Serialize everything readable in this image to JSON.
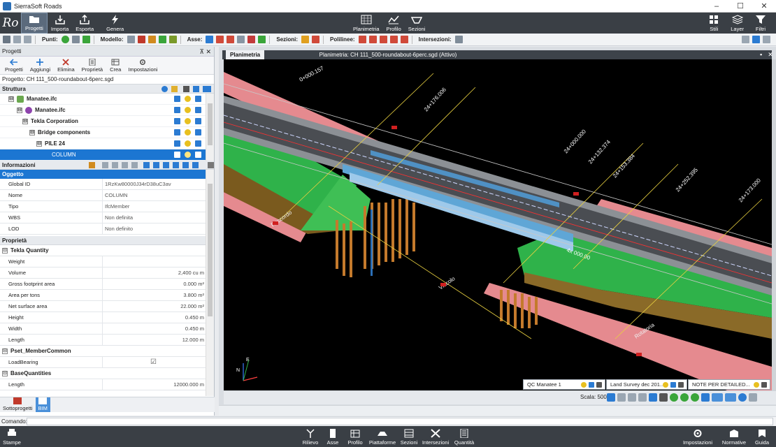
{
  "app": {
    "title": "SierraSoft Roads",
    "logo_text": "Ro",
    "window_controls": [
      "–",
      "☐",
      "✕"
    ]
  },
  "ribbon": {
    "left": [
      {
        "label": "Progetti",
        "icon": "folder-icon",
        "active": true
      },
      {
        "label": "Importa",
        "icon": "import-icon"
      },
      {
        "label": "Esporta",
        "icon": "export-icon"
      },
      {
        "label": "Genera",
        "icon": "generate-icon"
      }
    ],
    "center": [
      {
        "label": "Planimetria",
        "icon": "plan-icon"
      },
      {
        "label": "Profilo",
        "icon": "profile-icon"
      },
      {
        "label": "Sezioni",
        "icon": "sections-icon"
      }
    ],
    "right": [
      {
        "label": "Stili",
        "icon": "styles-icon"
      },
      {
        "label": "Layer",
        "icon": "layer-icon"
      },
      {
        "label": "Filtri",
        "icon": "filter-icon"
      }
    ]
  },
  "toolbar": {
    "groups": [
      {
        "label": "Punti:"
      },
      {
        "label": "Modello:"
      },
      {
        "label": "Asse:"
      },
      {
        "label": "Sezioni:"
      },
      {
        "label": "Polilinee:"
      },
      {
        "label": "Intersezioni:"
      }
    ]
  },
  "left_panel": {
    "title": "Progetti",
    "pin": "⊼ ✕",
    "buttons": [
      {
        "label": "Progetti",
        "icon": "back-arrow-icon"
      },
      {
        "label": "Aggiungi",
        "icon": "add-icon"
      },
      {
        "label": "Elimina",
        "icon": "delete-icon"
      },
      {
        "label": "Proprietà",
        "icon": "properties-icon"
      },
      {
        "label": "Crea",
        "icon": "create-icon"
      },
      {
        "label": "Impostazioni",
        "icon": "settings-icon"
      }
    ],
    "project_label": "Progetto: CH 111_500-roundabout-6perc.sgd",
    "structure_title": "Struttura",
    "tree": [
      {
        "label": "Manatee.ifc",
        "level": 0,
        "expander": "⊟"
      },
      {
        "label": "Manatee.ifc",
        "level": 1,
        "expander": "⊟"
      },
      {
        "label": "Tekla Corporation",
        "level": 2,
        "expander": "⊟"
      },
      {
        "label": "Bridge components",
        "level": 3,
        "expander": "⊟"
      },
      {
        "label": "PILE 24",
        "level": 4,
        "expander": "⊟"
      },
      {
        "label": "COLUMN",
        "level": 5,
        "expander": "",
        "selected": true
      }
    ],
    "info_title": "Informazioni",
    "object_header": "Oggetto",
    "object_props": [
      {
        "key": "Global ID",
        "value": "1RzKw80000J34rD38uC3av"
      },
      {
        "key": "Nome",
        "value": "COLUMN"
      },
      {
        "key": "Tipo",
        "value": "IfcMember"
      },
      {
        "key": "WBS",
        "value": "Non definita"
      },
      {
        "key": "LOD",
        "value": "Non definito"
      }
    ],
    "properties_title": "Proprietà",
    "groups": [
      {
        "name": "Tekla Quantity",
        "rows": [
          {
            "key": "Weight",
            "value": ""
          },
          {
            "key": "Volume",
            "value": "2,400 cu m"
          },
          {
            "key": "Gross footprint area",
            "value": "0.000 m²"
          },
          {
            "key": "Area per tons",
            "value": "3.800 m²"
          },
          {
            "key": "Net surface area",
            "value": "22.000 m²"
          },
          {
            "key": "Height",
            "value": "0.450 m"
          },
          {
            "key": "Width",
            "value": "0.450 m"
          },
          {
            "key": "Length",
            "value": "12.000 m"
          }
        ]
      },
      {
        "name": "Pset_MemberCommon",
        "rows": [
          {
            "key": "LoadBearing",
            "value": "☑"
          }
        ]
      },
      {
        "name": "BaseQuantities",
        "rows": [
          {
            "key": "Length",
            "value": "12000.000 m"
          }
        ]
      }
    ],
    "bottom_tabs": [
      {
        "label": "Sottoprogetti",
        "icon": "subprojects-icon"
      },
      {
        "label": "BIM",
        "icon": "bim-icon",
        "active": true
      }
    ]
  },
  "document": {
    "tab": "Planimetria",
    "info": "Planimetria: CH 111_500-roundabout-6perc.sgd (Attivo)",
    "controls": [
      "▪",
      "✕"
    ],
    "scene_labels": [
      "0+000.157",
      "24+176.006",
      "24+132.374",
      "24+153.384",
      "24+252.395",
      "24+000.000",
      "24+173.000",
      "4x 000.00",
      "Raccordo",
      "Vincolo",
      "Rotatoria"
    ],
    "axis_labels": {
      "n": "N",
      "e": "E"
    },
    "layers": [
      {
        "label": "QC Manatee 1"
      },
      {
        "label": "Land Survey dec 201..."
      },
      {
        "label": "NOTE PER DETAILED..."
      }
    ],
    "scale_label": "Scala: 500"
  },
  "command": {
    "label": "Comando:",
    "value": ""
  },
  "bottom_bar": {
    "left": [
      {
        "label": "Stampe",
        "icon": "print-icon"
      }
    ],
    "center": [
      {
        "label": "Rilievo",
        "icon": "survey-icon"
      },
      {
        "label": "Asse",
        "icon": "axis-icon"
      },
      {
        "label": "Profilo",
        "icon": "profile-icon"
      },
      {
        "label": "Piattaforme",
        "icon": "platform-icon"
      },
      {
        "label": "Sezioni",
        "icon": "sections-icon"
      },
      {
        "label": "Intersezioni",
        "icon": "intersections-icon"
      },
      {
        "label": "Quantità",
        "icon": "quantity-icon"
      }
    ],
    "right": [
      {
        "label": "Impostazioni",
        "icon": "settings-icon"
      },
      {
        "label": "Normative",
        "icon": "norms-icon"
      },
      {
        "label": "Guida",
        "icon": "help-icon"
      }
    ]
  },
  "colors": {
    "ribbon_bg": "#3a3f45",
    "accent": "#1c76d2",
    "road_gray": "#4a4d52",
    "embankment_green": "#2fb24a",
    "terrain_pink": "#e58a8f",
    "pile_orange": "#c47a2c"
  }
}
